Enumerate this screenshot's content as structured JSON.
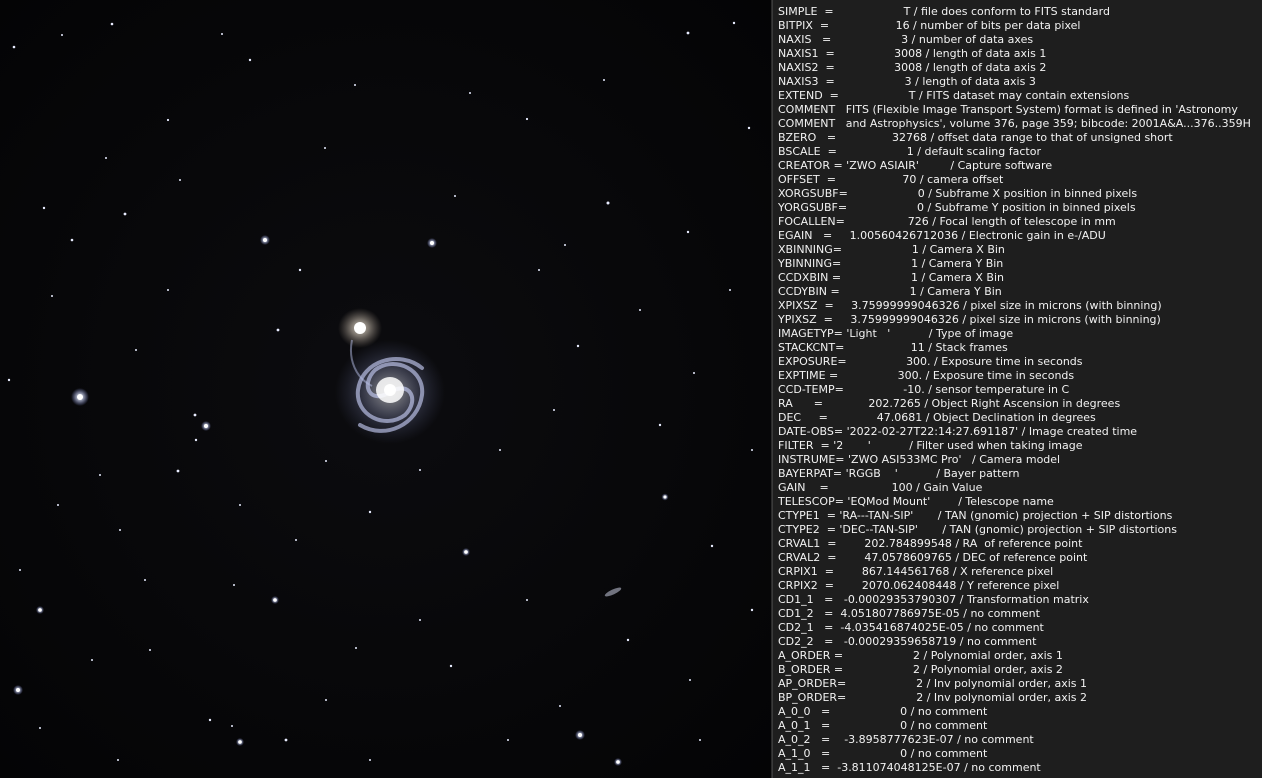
{
  "image": {
    "description_icon": "galaxy-image",
    "background_color": "#060608"
  },
  "header_lines": [
    "SIMPLE  =                    T / file does conform to FITS standard",
    "BITPIX  =                   16 / number of bits per data pixel",
    "NAXIS   =                    3 / number of data axes",
    "NAXIS1  =                 3008 / length of data axis 1",
    "NAXIS2  =                 3008 / length of data axis 2",
    "NAXIS3  =                    3 / length of data axis 3",
    "EXTEND  =                    T / FITS dataset may contain extensions",
    "COMMENT   FITS (Flexible Image Transport System) format is defined in 'Astronomy",
    "COMMENT   and Astrophysics', volume 376, page 359; bibcode: 2001A&A...376..359H",
    "BZERO   =                32768 / offset data range to that of unsigned short",
    "BSCALE  =                    1 / default scaling factor",
    "CREATOR = 'ZWO ASIAIR'         / Capture software",
    "OFFSET  =                   70 / camera offset",
    "XORGSUBF=                    0 / Subframe X position in binned pixels",
    "YORGSUBF=                    0 / Subframe Y position in binned pixels",
    "FOCALLEN=                  726 / Focal length of telescope in mm",
    "EGAIN   =     1.00560426712036 / Electronic gain in e-/ADU",
    "XBINNING=                    1 / Camera X Bin",
    "YBINNING=                    1 / Camera Y Bin",
    "CCDXBIN =                    1 / Camera X Bin",
    "CCDYBIN =                    1 / Camera Y Bin",
    "XPIXSZ  =     3.75999999046326 / pixel size in microns (with binning)",
    "YPIXSZ  =     3.75999999046326 / pixel size in microns (with binning)",
    "IMAGETYP= 'Light   '           / Type of image",
    "STACKCNT=                   11 / Stack frames",
    "EXPOSURE=                 300. / Exposure time in seconds",
    "EXPTIME =                 300. / Exposure time in seconds",
    "CCD-TEMP=                 -10. / sensor temperature in C",
    "RA      =             202.7265 / Object Right Ascension in degrees",
    "DEC     =              47.0681 / Object Declination in degrees",
    "DATE-OBS= '2022-02-27T22:14:27.691187' / Image created time",
    "FILTER  = '2       '           / Filter used when taking image",
    "INSTRUME= 'ZWO ASI533MC Pro'   / Camera model",
    "BAYERPAT= 'RGGB    '           / Bayer pattern",
    "GAIN    =                  100 / Gain Value",
    "TELESCOP= 'EQMod Mount'        / Telescope name",
    "CTYPE1  = 'RA---TAN-SIP'       / TAN (gnomic) projection + SIP distortions",
    "CTYPE2  = 'DEC--TAN-SIP'       / TAN (gnomic) projection + SIP distortions",
    "CRVAL1  =        202.784899548 / RA  of reference point",
    "CRVAL2  =        47.0578609765 / DEC of reference point",
    "CRPIX1  =        867.144561768 / X reference pixel",
    "CRPIX2  =        2070.062408448 / Y reference pixel",
    "CD1_1   =   -0.00029353790307 / Transformation matrix",
    "CD1_2   =  4.051807786975E-05 / no comment",
    "CD2_1   =  -4.035416874025E-05 / no comment",
    "CD2_2   =   -0.00029359658719 / no comment",
    "A_ORDER =                    2 / Polynomial order, axis 1",
    "B_ORDER =                    2 / Polynomial order, axis 2",
    "AP_ORDER=                    2 / Inv polynomial order, axis 1",
    "BP_ORDER=                    2 / Inv polynomial order, axis 2",
    "A_0_0   =                    0 / no comment",
    "A_0_1   =                    0 / no comment",
    "A_0_2   =    -3.8958777623E-07 / no comment",
    "A_1_0   =                    0 / no comment",
    "A_1_1   =  -3.811074048125E-07 / no comment"
  ]
}
